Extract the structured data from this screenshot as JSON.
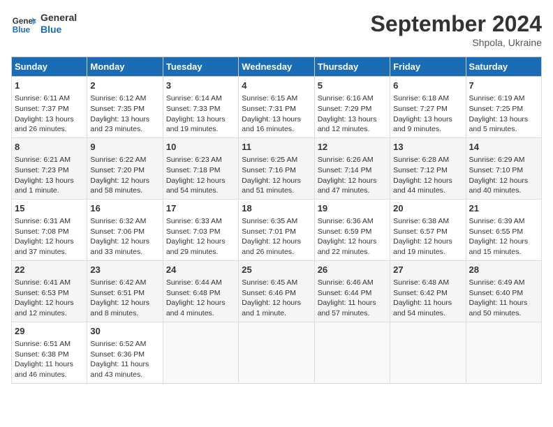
{
  "header": {
    "logo_line1": "General",
    "logo_line2": "Blue",
    "month": "September 2024",
    "location": "Shpola, Ukraine"
  },
  "days_of_week": [
    "Sunday",
    "Monday",
    "Tuesday",
    "Wednesday",
    "Thursday",
    "Friday",
    "Saturday"
  ],
  "weeks": [
    [
      {
        "day": 1,
        "lines": [
          "Sunrise: 6:11 AM",
          "Sunset: 7:37 PM",
          "Daylight: 13 hours",
          "and 26 minutes."
        ]
      },
      {
        "day": 2,
        "lines": [
          "Sunrise: 6:12 AM",
          "Sunset: 7:35 PM",
          "Daylight: 13 hours",
          "and 23 minutes."
        ]
      },
      {
        "day": 3,
        "lines": [
          "Sunrise: 6:14 AM",
          "Sunset: 7:33 PM",
          "Daylight: 13 hours",
          "and 19 minutes."
        ]
      },
      {
        "day": 4,
        "lines": [
          "Sunrise: 6:15 AM",
          "Sunset: 7:31 PM",
          "Daylight: 13 hours",
          "and 16 minutes."
        ]
      },
      {
        "day": 5,
        "lines": [
          "Sunrise: 6:16 AM",
          "Sunset: 7:29 PM",
          "Daylight: 13 hours",
          "and 12 minutes."
        ]
      },
      {
        "day": 6,
        "lines": [
          "Sunrise: 6:18 AM",
          "Sunset: 7:27 PM",
          "Daylight: 13 hours",
          "and 9 minutes."
        ]
      },
      {
        "day": 7,
        "lines": [
          "Sunrise: 6:19 AM",
          "Sunset: 7:25 PM",
          "Daylight: 13 hours",
          "and 5 minutes."
        ]
      }
    ],
    [
      {
        "day": 8,
        "lines": [
          "Sunrise: 6:21 AM",
          "Sunset: 7:23 PM",
          "Daylight: 13 hours",
          "and 1 minute."
        ]
      },
      {
        "day": 9,
        "lines": [
          "Sunrise: 6:22 AM",
          "Sunset: 7:20 PM",
          "Daylight: 12 hours",
          "and 58 minutes."
        ]
      },
      {
        "day": 10,
        "lines": [
          "Sunrise: 6:23 AM",
          "Sunset: 7:18 PM",
          "Daylight: 12 hours",
          "and 54 minutes."
        ]
      },
      {
        "day": 11,
        "lines": [
          "Sunrise: 6:25 AM",
          "Sunset: 7:16 PM",
          "Daylight: 12 hours",
          "and 51 minutes."
        ]
      },
      {
        "day": 12,
        "lines": [
          "Sunrise: 6:26 AM",
          "Sunset: 7:14 PM",
          "Daylight: 12 hours",
          "and 47 minutes."
        ]
      },
      {
        "day": 13,
        "lines": [
          "Sunrise: 6:28 AM",
          "Sunset: 7:12 PM",
          "Daylight: 12 hours",
          "and 44 minutes."
        ]
      },
      {
        "day": 14,
        "lines": [
          "Sunrise: 6:29 AM",
          "Sunset: 7:10 PM",
          "Daylight: 12 hours",
          "and 40 minutes."
        ]
      }
    ],
    [
      {
        "day": 15,
        "lines": [
          "Sunrise: 6:31 AM",
          "Sunset: 7:08 PM",
          "Daylight: 12 hours",
          "and 37 minutes."
        ]
      },
      {
        "day": 16,
        "lines": [
          "Sunrise: 6:32 AM",
          "Sunset: 7:06 PM",
          "Daylight: 12 hours",
          "and 33 minutes."
        ]
      },
      {
        "day": 17,
        "lines": [
          "Sunrise: 6:33 AM",
          "Sunset: 7:03 PM",
          "Daylight: 12 hours",
          "and 29 minutes."
        ]
      },
      {
        "day": 18,
        "lines": [
          "Sunrise: 6:35 AM",
          "Sunset: 7:01 PM",
          "Daylight: 12 hours",
          "and 26 minutes."
        ]
      },
      {
        "day": 19,
        "lines": [
          "Sunrise: 6:36 AM",
          "Sunset: 6:59 PM",
          "Daylight: 12 hours",
          "and 22 minutes."
        ]
      },
      {
        "day": 20,
        "lines": [
          "Sunrise: 6:38 AM",
          "Sunset: 6:57 PM",
          "Daylight: 12 hours",
          "and 19 minutes."
        ]
      },
      {
        "day": 21,
        "lines": [
          "Sunrise: 6:39 AM",
          "Sunset: 6:55 PM",
          "Daylight: 12 hours",
          "and 15 minutes."
        ]
      }
    ],
    [
      {
        "day": 22,
        "lines": [
          "Sunrise: 6:41 AM",
          "Sunset: 6:53 PM",
          "Daylight: 12 hours",
          "and 12 minutes."
        ]
      },
      {
        "day": 23,
        "lines": [
          "Sunrise: 6:42 AM",
          "Sunset: 6:51 PM",
          "Daylight: 12 hours",
          "and 8 minutes."
        ]
      },
      {
        "day": 24,
        "lines": [
          "Sunrise: 6:44 AM",
          "Sunset: 6:48 PM",
          "Daylight: 12 hours",
          "and 4 minutes."
        ]
      },
      {
        "day": 25,
        "lines": [
          "Sunrise: 6:45 AM",
          "Sunset: 6:46 PM",
          "Daylight: 12 hours",
          "and 1 minute."
        ]
      },
      {
        "day": 26,
        "lines": [
          "Sunrise: 6:46 AM",
          "Sunset: 6:44 PM",
          "Daylight: 11 hours",
          "and 57 minutes."
        ]
      },
      {
        "day": 27,
        "lines": [
          "Sunrise: 6:48 AM",
          "Sunset: 6:42 PM",
          "Daylight: 11 hours",
          "and 54 minutes."
        ]
      },
      {
        "day": 28,
        "lines": [
          "Sunrise: 6:49 AM",
          "Sunset: 6:40 PM",
          "Daylight: 11 hours",
          "and 50 minutes."
        ]
      }
    ],
    [
      {
        "day": 29,
        "lines": [
          "Sunrise: 6:51 AM",
          "Sunset: 6:38 PM",
          "Daylight: 11 hours",
          "and 46 minutes."
        ]
      },
      {
        "day": 30,
        "lines": [
          "Sunrise: 6:52 AM",
          "Sunset: 6:36 PM",
          "Daylight: 11 hours",
          "and 43 minutes."
        ]
      },
      null,
      null,
      null,
      null,
      null
    ]
  ]
}
